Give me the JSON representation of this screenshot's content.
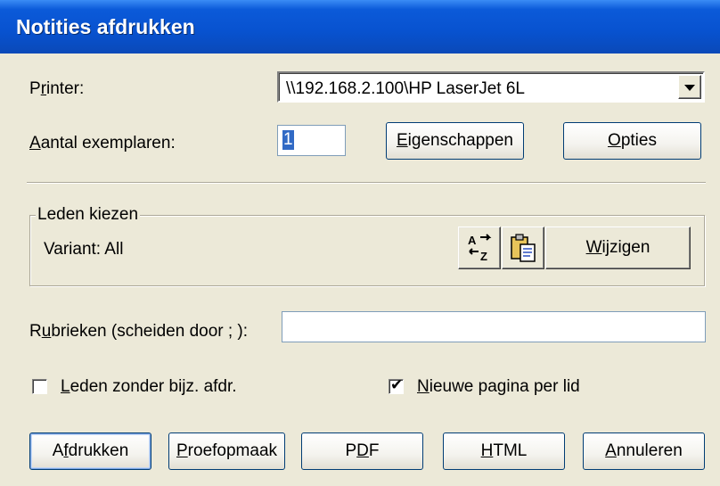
{
  "window": {
    "title": "Notities afdrukken"
  },
  "printer": {
    "label": "Printer:",
    "value": "\\\\192.168.2.100\\HP LaserJet 6L"
  },
  "copies": {
    "label": "Aantal exemplaren:",
    "value": "1"
  },
  "buttons_top": {
    "properties": "Eigenschappen",
    "options": "Opties"
  },
  "members_group": {
    "legend": "Leden kiezen",
    "variant_text": "Variant: All",
    "sort_icon": "sort-az-icon",
    "clipboard_icon": "clipboard-icon",
    "change_label": "Wijzigen"
  },
  "sections": {
    "label": "Rubrieken (scheiden door ; ):",
    "value": ""
  },
  "checkboxes": [
    {
      "label": "Leden zonder bijz. afdr.",
      "checked": false
    },
    {
      "label": "Nieuwe pagina per lid",
      "checked": true
    }
  ],
  "buttons_bottom": {
    "print": "Afdrukken",
    "preview": "Proefopmaak",
    "pdf": "PDF",
    "html": "HTML",
    "cancel": "Annuleren"
  }
}
